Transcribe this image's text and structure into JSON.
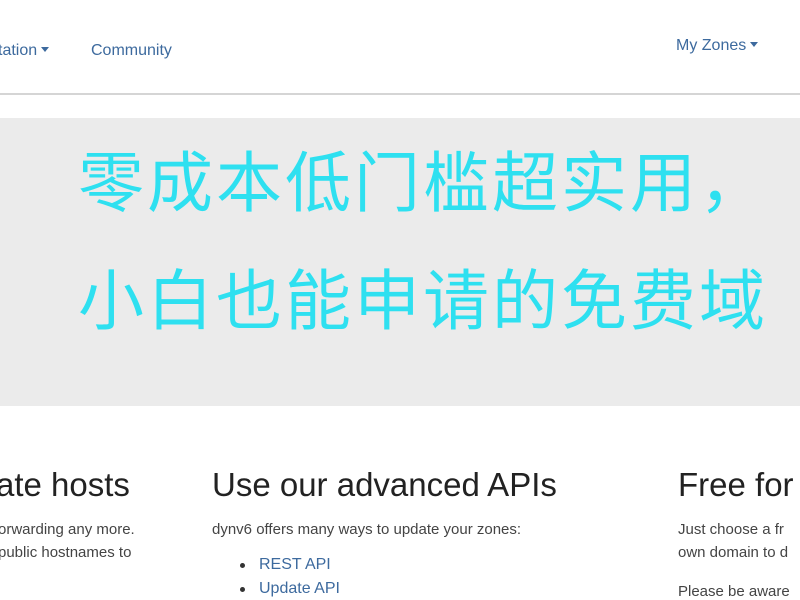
{
  "navbar": {
    "documentation_label": "tation",
    "community_label": "Community",
    "my_zones_label": "My Zones"
  },
  "hero": {
    "line1": "零成本低门槛超实用，",
    "line2": "小白也能申请的免费域",
    "text_color": "#2ee0f0",
    "background": "#ebebeb"
  },
  "columns": [
    {
      "heading": "ate hosts",
      "text": [
        "orwarding any more.",
        "public hostnames to"
      ]
    },
    {
      "heading": "Use our advanced APIs",
      "text": [
        "dynv6 offers many ways to update your zones:"
      ],
      "links": [
        "REST API",
        "Update API"
      ]
    },
    {
      "heading": "Free for",
      "text": [
        "Just choose a fr",
        "own domain to d"
      ],
      "note": "Please be aware"
    }
  ],
  "colors": {
    "link": "#3d6a9e",
    "heading": "#222222"
  }
}
